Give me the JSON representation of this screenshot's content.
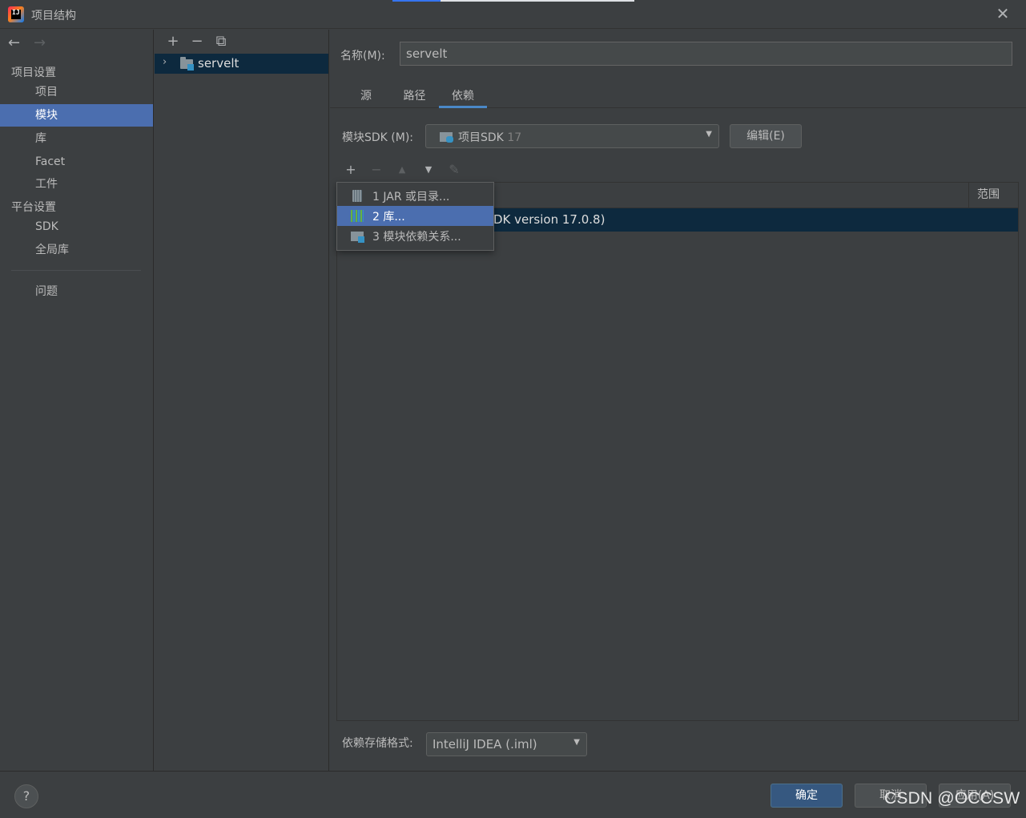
{
  "window": {
    "title": "项目结构",
    "app_icon_text": "IJ",
    "close_glyph": "✕"
  },
  "nav": {
    "back": "←",
    "forward": "→",
    "sections": [
      {
        "label": "项目设置"
      },
      {
        "label": "平台设置"
      }
    ],
    "items": [
      {
        "label": "项目"
      },
      {
        "label": "模块"
      },
      {
        "label": "库"
      },
      {
        "label": "Facet"
      },
      {
        "label": "工件"
      },
      {
        "label": "SDK"
      },
      {
        "label": "全局库"
      },
      {
        "label": "问题"
      }
    ]
  },
  "tree": {
    "toolbar": {
      "add": "+",
      "remove": "−",
      "copy": "⧉"
    },
    "module": {
      "expand_glyph": "›",
      "name": "servelt"
    }
  },
  "module_settings": {
    "name_label": "名称(M):",
    "name_value": "servelt",
    "tabs": [
      {
        "label": "源"
      },
      {
        "label": "路径"
      },
      {
        "label": "依赖",
        "active": true
      }
    ],
    "sdk_label": "模块SDK (M):",
    "sdk_value": "项目SDK",
    "sdk_version": "17",
    "sdk_arrow": "▼",
    "edit_button": "编辑(E)",
    "dep_toolbar": {
      "add": "+",
      "remove": "−",
      "up": "▲",
      "down": "▼",
      "edit": "✎"
    },
    "table": {
      "scope_header": "范围",
      "row_text": "DK version 17.0.8)"
    },
    "storage_label": "依赖存储格式:",
    "storage_value": "IntelliJ IDEA (.iml)",
    "storage_arrow": "▼"
  },
  "popup_menu": {
    "items": [
      {
        "label": "1  JAR 或目录...",
        "icon": "jar-icon"
      },
      {
        "label": "2  库...",
        "icon": "library-icon",
        "selected": true
      },
      {
        "label": "3  模块依赖关系...",
        "icon": "module-icon"
      }
    ]
  },
  "footer": {
    "help": "?",
    "ok": "确定",
    "cancel": "取消",
    "apply": "应用(A)"
  },
  "watermark": "CSDN @OCCSW",
  "colors": {
    "background": "#3c3f41",
    "selection": "#4b6eaf",
    "row_selection": "#0d293e",
    "accent": "#365880"
  }
}
